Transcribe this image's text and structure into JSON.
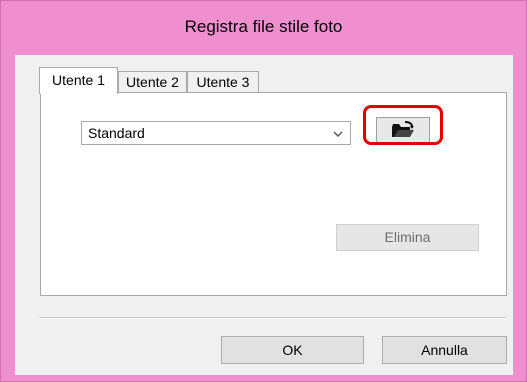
{
  "window": {
    "title": "Registra file stile foto"
  },
  "tabs": [
    {
      "label": "Utente 1",
      "active": true
    },
    {
      "label": "Utente 2",
      "active": false
    },
    {
      "label": "Utente 3",
      "active": false
    }
  ],
  "style_select": {
    "value": "Standard"
  },
  "load_button": {
    "icon": "open-folder-icon"
  },
  "delete_button": {
    "label": "Elimina",
    "enabled": false
  },
  "footer": {
    "ok_label": "OK",
    "cancel_label": "Annulla"
  },
  "colors": {
    "title_bar": "#f08fd0",
    "highlight": "#e00000"
  }
}
